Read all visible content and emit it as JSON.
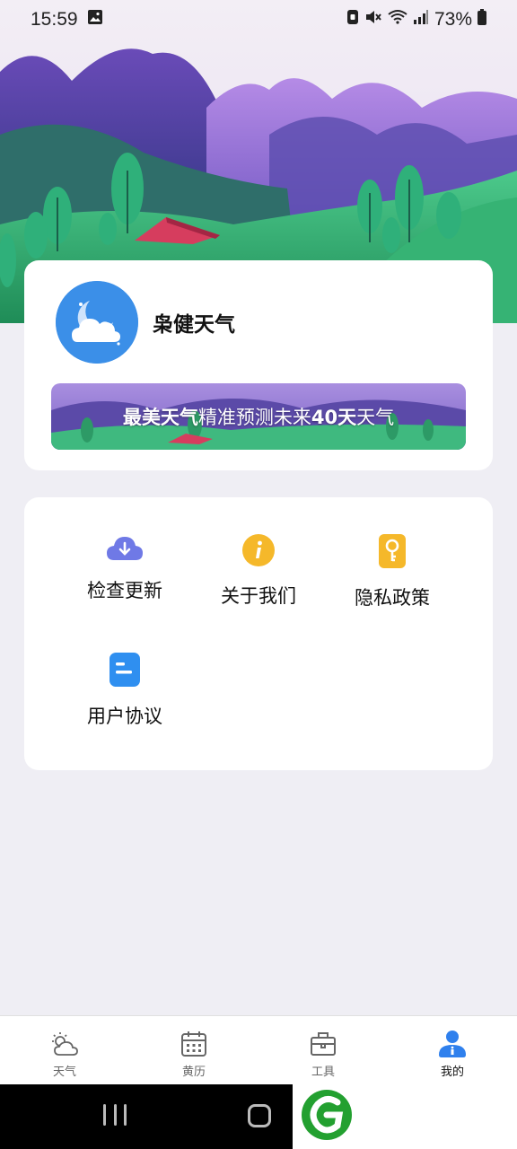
{
  "status_bar": {
    "time": "15:59",
    "battery": "73%"
  },
  "profile": {
    "app_name": "枭健天气",
    "banner": {
      "part1": "最美天气",
      "part2": "精准预测未来",
      "part3": "40天",
      "part4": "天气"
    }
  },
  "menu": {
    "items": [
      {
        "label": "检查更新",
        "icon": "cloud-download-icon"
      },
      {
        "label": "关于我们",
        "icon": "info-icon"
      },
      {
        "label": "隐私政策",
        "icon": "privacy-key-icon"
      },
      {
        "label": "用户协议",
        "icon": "document-icon"
      }
    ]
  },
  "tabs": [
    {
      "label": "天气",
      "icon": "weather-icon"
    },
    {
      "label": "黄历",
      "icon": "calendar-icon"
    },
    {
      "label": "工具",
      "icon": "toolbox-icon"
    },
    {
      "label": "我的",
      "icon": "user-icon",
      "active": true
    }
  ],
  "colors": {
    "background": "#efeef4",
    "accent_blue": "#3b8fe8",
    "info_yellow": "#f5b82a",
    "update_purple": "#6f79e6",
    "doc_blue": "#2f8ff0"
  }
}
